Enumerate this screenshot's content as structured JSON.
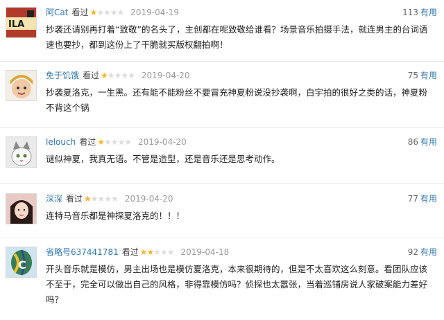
{
  "helpful_label": "有用",
  "colors": {
    "username": "#3377aa",
    "star_on": "#f7b52c",
    "star_off": "#dcdcdc",
    "date": "#999999"
  },
  "reviews": [
    {
      "user": "阿Cat",
      "status": "看过",
      "rating": 1,
      "date": "2019-04-19",
      "helpful_count": "113",
      "text": "抄袭还请别再打着“致敬”的名头了，主创都在呢致敬给谁看？场景音乐拍摄手法，就连男主的台词语速也要抄，都到这份上了干脆就买版权翻拍啊！"
    },
    {
      "user": "免于饥饿",
      "status": "看过",
      "rating": 1,
      "date": "2019-04-20",
      "helpful_count": "75",
      "text": "抄袭夏洛克，一生黑。还有能不能粉丝不要冒充神夏粉说没抄袭啊，白宇拍的很好之类的话，神夏粉不背这个锅"
    },
    {
      "user": "lelouch",
      "status": "看过",
      "rating": 1,
      "date": "2019-04-20",
      "helpful_count": "86",
      "text": "谜似神夏，我真无语。不管是造型，还是音乐还是思考动作。"
    },
    {
      "user": "深深",
      "status": "看过",
      "rating": 1,
      "date": "2019-04-20",
      "helpful_count": "77",
      "text": "连特马音乐都是神探夏洛克的！！！"
    },
    {
      "user": "省略号637441781",
      "status": "看过",
      "rating": 2,
      "date": "2019-04-18",
      "helpful_count": "92",
      "text": "开头音乐就是模仿，男主出场也是模仿夏洛克，本来很期待的，但是不太喜欢这么刻意。看团队应该不至于，完全可以做出自己的风格，非得靠模仿吗？侦探也太嚣张，当着巡铺房说人家破案能力差好吗？"
    }
  ]
}
